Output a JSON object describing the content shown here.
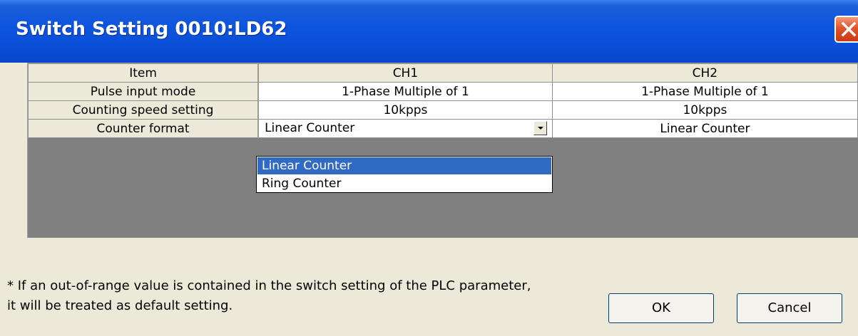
{
  "window": {
    "title": "Switch Setting 0010:LD62"
  },
  "table": {
    "columns": [
      "Item",
      "CH1",
      "CH2"
    ],
    "rows": [
      {
        "item": "Pulse input mode",
        "ch1": "1-Phase Multiple of 1",
        "ch2": "1-Phase Multiple of 1"
      },
      {
        "item": "Counting speed setting",
        "ch1": "10kpps",
        "ch2": "10kpps"
      },
      {
        "item": "Counter format",
        "ch1": "Linear Counter",
        "ch2": "Linear Counter"
      }
    ]
  },
  "dropdown": {
    "options": [
      "Linear Counter",
      "Ring Counter"
    ],
    "highlighted": "Linear Counter"
  },
  "footnote": {
    "line1": "* If an out-of-range value is contained in the switch setting of the PLC parameter,",
    "line2": "it will be treated as default setting."
  },
  "buttons": {
    "ok": "OK",
    "cancel": "Cancel"
  },
  "colors": {
    "titlebar": "#0a4ed6",
    "selection": "#316ac5",
    "dialog_bg": "#ece9d8",
    "grid_bg": "#808080"
  },
  "icons": {
    "close": "close-icon",
    "combo_arrow": "chevron-down-icon"
  }
}
